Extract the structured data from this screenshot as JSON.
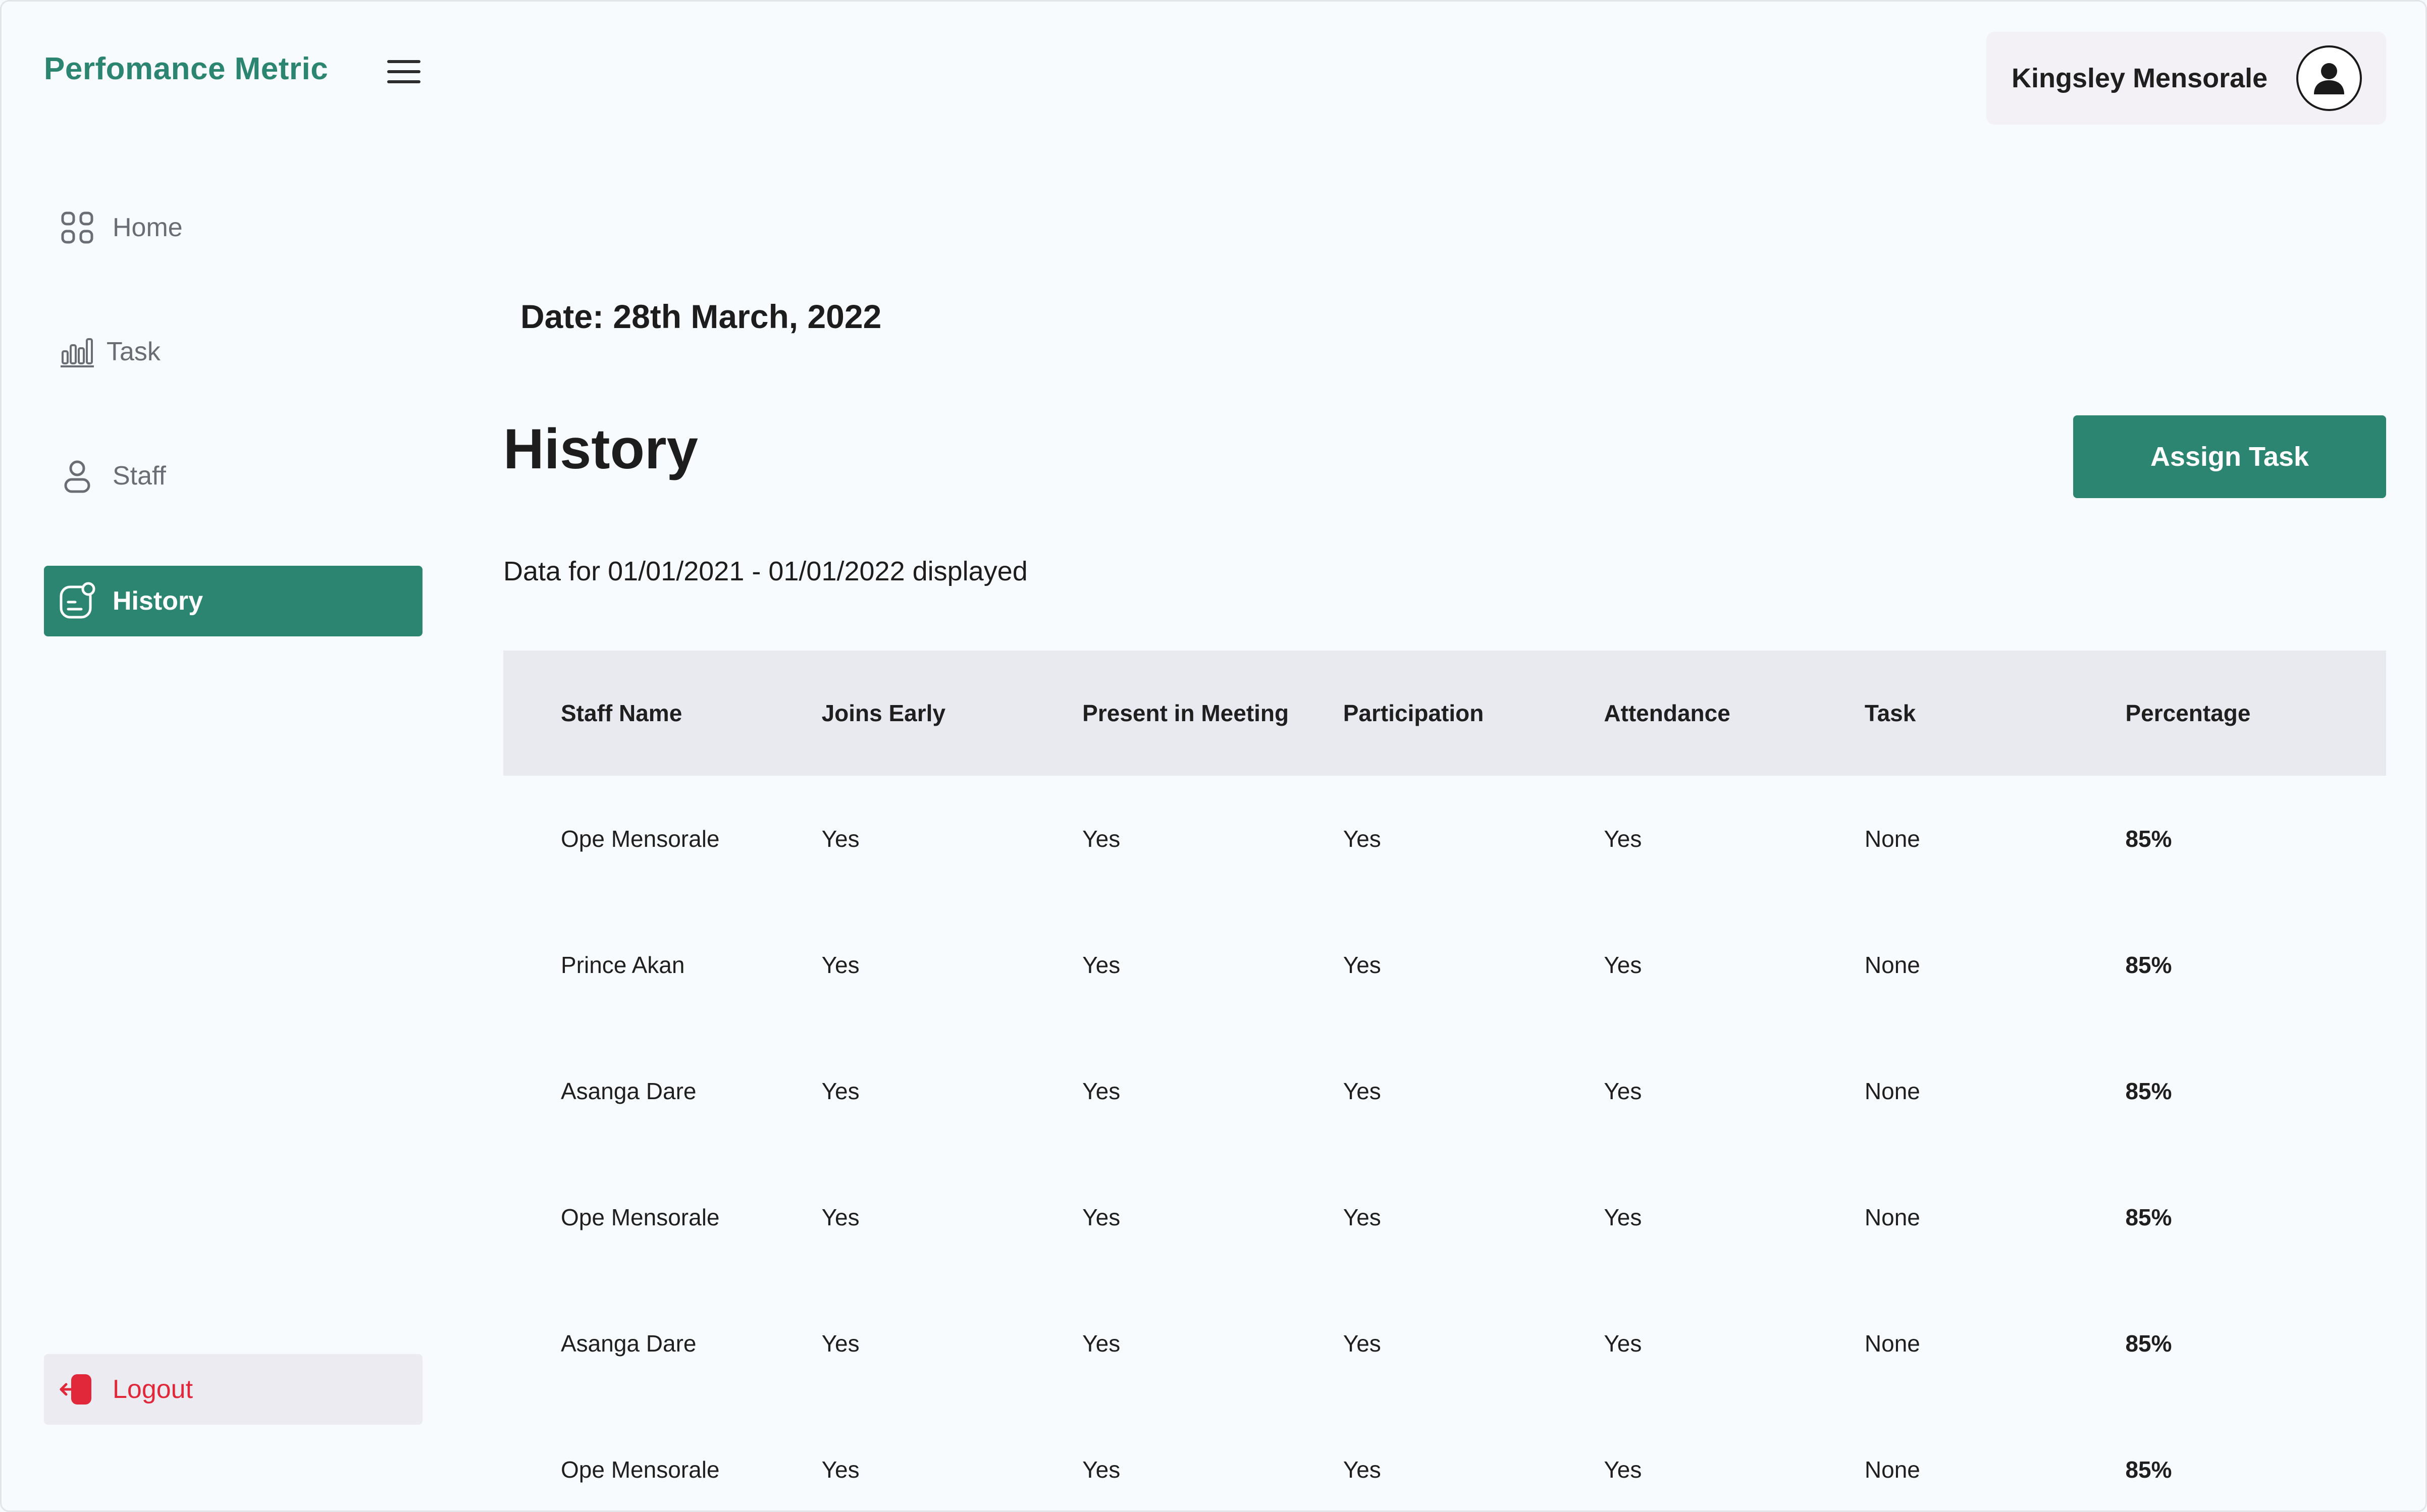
{
  "app": {
    "brand": "Perfomance Metric"
  },
  "sidebar": {
    "items": [
      {
        "label": "Home",
        "icon": "grid-icon"
      },
      {
        "label": "Task",
        "icon": "bar-chart-icon"
      },
      {
        "label": "Staff",
        "icon": "user-icon"
      },
      {
        "label": "History",
        "icon": "history-icon",
        "active": true
      }
    ],
    "logout": {
      "label": "Logout",
      "icon": "logout-icon"
    }
  },
  "header": {
    "user_name": "Kingsley Mensorale"
  },
  "main": {
    "date": "Date: 28th March, 2022",
    "title": "History",
    "assign_button": "Assign Task",
    "range_text": "Data for 01/01/2021 - 01/01/2022 displayed"
  },
  "table": {
    "columns": [
      "Staff Name",
      "Joins Early",
      "Present in Meeting",
      "Participation",
      "Attendance",
      "Task",
      "Percentage"
    ],
    "rows": [
      [
        "Ope Mensorale",
        "Yes",
        "Yes",
        "Yes",
        "Yes",
        "None",
        "85%"
      ],
      [
        "Prince Akan",
        "Yes",
        "Yes",
        "Yes",
        "Yes",
        "None",
        "85%"
      ],
      [
        "Asanga Dare",
        "Yes",
        "Yes",
        "Yes",
        "Yes",
        "None",
        "85%"
      ],
      [
        "Ope Mensorale",
        "Yes",
        "Yes",
        "Yes",
        "Yes",
        "None",
        "85%"
      ],
      [
        "Asanga Dare",
        "Yes",
        "Yes",
        "Yes",
        "Yes",
        "None",
        "85%"
      ],
      [
        "Ope Mensorale",
        "Yes",
        "Yes",
        "Yes",
        "Yes",
        "None",
        "85%"
      ]
    ]
  },
  "colors": {
    "accent": "#2b8570",
    "logout": "#e0283a",
    "header_bg": "#e9e9f0"
  }
}
